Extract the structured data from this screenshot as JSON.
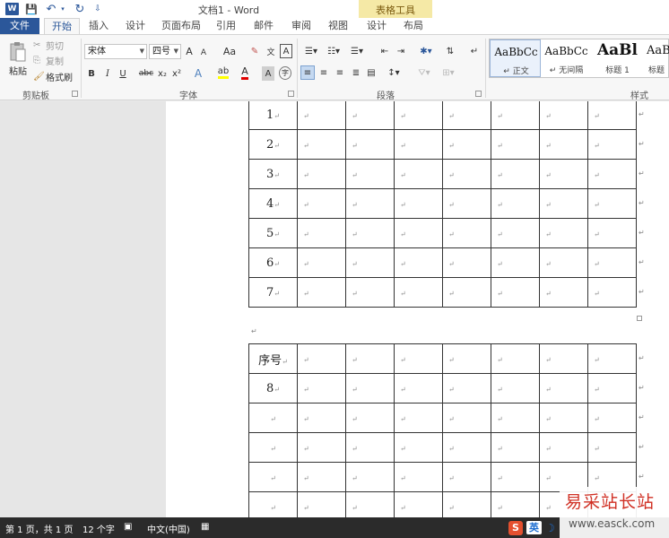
{
  "title_bar": {
    "word_logo": "W",
    "save_icon": "💾",
    "undo_icon": "↶",
    "redo_icon": "↻",
    "customize_icon": "⇩",
    "document_title": "文档1 - Word",
    "context_tab_group": "表格工具"
  },
  "tabs": [
    "文件",
    "开始",
    "插入",
    "设计",
    "页面布局",
    "引用",
    "邮件",
    "审阅",
    "视图",
    "设计",
    "布局"
  ],
  "active_tab": "开始",
  "ribbon": {
    "clipboard": {
      "paste_label": "粘贴",
      "cut_label": "剪切",
      "copy_label": "复制",
      "format_painter_label": "格式刷",
      "group_label": "剪贴板"
    },
    "font": {
      "font_name": "宋体",
      "font_size": "四号",
      "grow_label": "A",
      "shrink_label": "A",
      "case_label": "Aa",
      "bold": "B",
      "italic": "I",
      "underline": "U",
      "strike": "abc",
      "subscript": "x₂",
      "superscript": "x²",
      "text_effect": "A",
      "highlight": "ab",
      "font_color": "A",
      "char_shading": "A",
      "group_label": "字体"
    },
    "paragraph": {
      "group_label": "段落"
    },
    "styles": {
      "group_label": "样式",
      "items": [
        {
          "sample": "AaBbCc",
          "name": "↵ 正文"
        },
        {
          "sample": "AaBbCc",
          "name": "↵ 无间隔"
        },
        {
          "sample": "AaBl",
          "name": "标题 1"
        },
        {
          "sample": "AaBb",
          "name": "标题"
        }
      ]
    }
  },
  "document": {
    "table1_rows": [
      "1",
      "2",
      "3",
      "4",
      "5",
      "6",
      "7"
    ],
    "table2_rows": [
      "序号",
      "8",
      "",
      "",
      "",
      ""
    ],
    "cell_mark": "↵"
  },
  "status_bar": {
    "page_info": "第 1 页，共 1 页",
    "word_count": "12 个字",
    "language": "中文(中国)",
    "ime_logo": "S",
    "ime_lang": "英",
    "ime_moon": "☽"
  },
  "watermark": {
    "name": "易采站长站",
    "url": "www.easck.com"
  }
}
